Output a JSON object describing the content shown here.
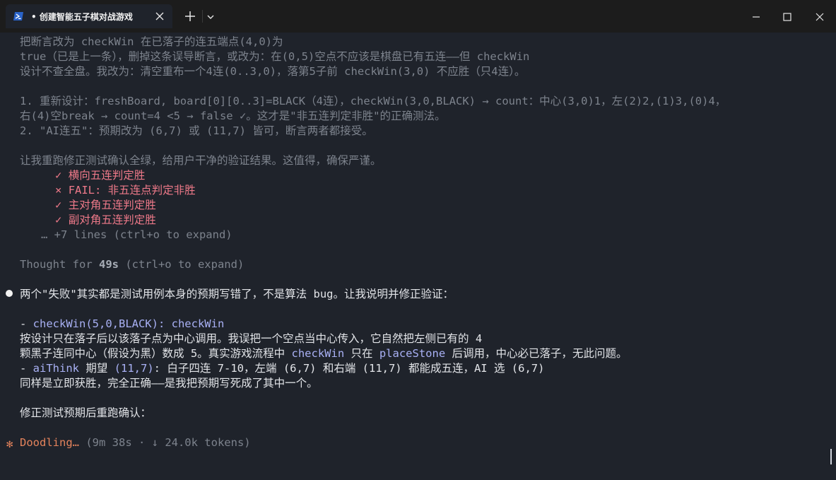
{
  "window": {
    "tab_title": "• 创建智能五子棋对战游戏",
    "icons": {
      "tab": "powershell-icon",
      "tab_close": "close-icon",
      "new_tab": "plus-icon",
      "dropdown": "chevron-down-icon",
      "minimize": "minimize-icon",
      "maximize": "maximize-icon",
      "close": "close-icon"
    }
  },
  "thinking": {
    "lines": [
      "把断言改为 checkWin 在已落子的连五端点(4,0)为",
      "true（已是上一条），删掉这条误导断言，或改为：在(0,5)空点不应该是棋盘已有五连——但 checkWin",
      "设计不查全盘。我改为：清空重布一个4连(0..3,0)，落第5子前 checkWin(3,0) 不应胜（只4连）。",
      "1. 重新设计：freshBoard, board[0][0..3]=BLACK（4连），checkWin(3,0,BLACK) → count：中心(3,0)1，左(2)2,(1)3,(0)4，",
      "右(4)空break → count=4 <5 → false ✓。这才是\"非五连判定非胜\"的正确测法。",
      "2. \"AI连五\"：预期改为 (6,7) 或 (11,7) 皆可，断言两者都接受。",
      "让我重跑修正测试确认全绿，给用户干净的验证结果。这值得，确保严谨。"
    ],
    "test_results": [
      {
        "icon": "✓",
        "label": "横向五连判定胜"
      },
      {
        "icon": "×",
        "label": "FAIL: 非五连点判定非胜"
      },
      {
        "icon": "✓",
        "label": "主对角五连判定胜"
      },
      {
        "icon": "✓",
        "label": "副对角五连判定胜"
      }
    ],
    "more_lines": "… +7 lines (ctrl+o to expand)",
    "thought_prefix": "Thought for ",
    "thought_time": "49s",
    "thought_suffix": " (ctrl+o to expand)"
  },
  "response": {
    "summary": "两个\"失败\"其实都是测试用例本身的预期写错了，不是算法 bug。让我说明并修正验证：",
    "item1_dash": "- ",
    "item1_code": "checkWin(5,0,BLACK): checkWin",
    "item1_line2": "按设计只在落子后以该落子点为中心调用。我误把一个空点当中心传入，它自然把左侧已有的 4",
    "item1_line3_a": "颗黑子连同中心（假设为黑）数成 5。真实游戏流程中 ",
    "item1_line3_code1": "checkWin",
    "item1_line3_b": " 只在 ",
    "item1_line3_code2": "placeStone",
    "item1_line3_c": " 后调用，中心必已落子，无此问题。",
    "item2_dash": "- ",
    "item2_code1": "aiThink",
    "item2_a": " 期望 ",
    "item2_code2": "(11,7)",
    "item2_b": ": 白子四连 7-10，左端 (6,7) 和右端 (11,7) 都能成五连，AI 选 (6,7)",
    "item2_line2": "同样是立即获胜，完全正确——是我把预期写死成了其中一个。",
    "closing": "修正测试预期后重跑确认："
  },
  "status": {
    "spinner": "✻",
    "label": "Doodling…",
    "detail": " (9m 38s · ↓ 24.0k tokens)"
  }
}
